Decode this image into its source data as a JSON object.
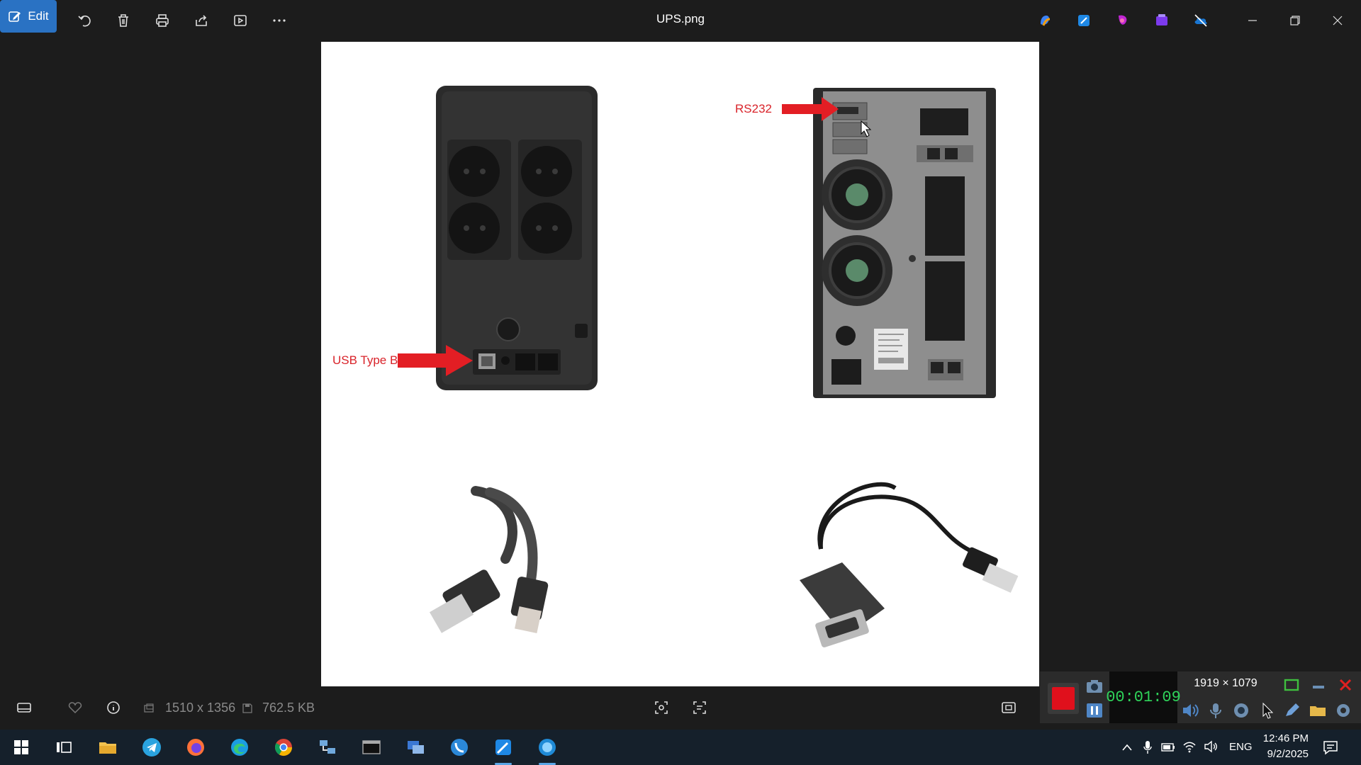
{
  "toolbar": {
    "edit_label": "Edit",
    "title": "UPS.png"
  },
  "image": {
    "label_rs232": "RS232",
    "label_usb": "USB Type B",
    "arrow_color": "#e31e24"
  },
  "bottombar": {
    "dimensions": "1510 x 1356",
    "file_size": "762.5 KB"
  },
  "recorder": {
    "resolution": "1919 × 1079",
    "timer": "00:01:09"
  },
  "taskbar": {
    "language": "ENG",
    "time": "12:46 PM",
    "date": "9/2/2025"
  }
}
